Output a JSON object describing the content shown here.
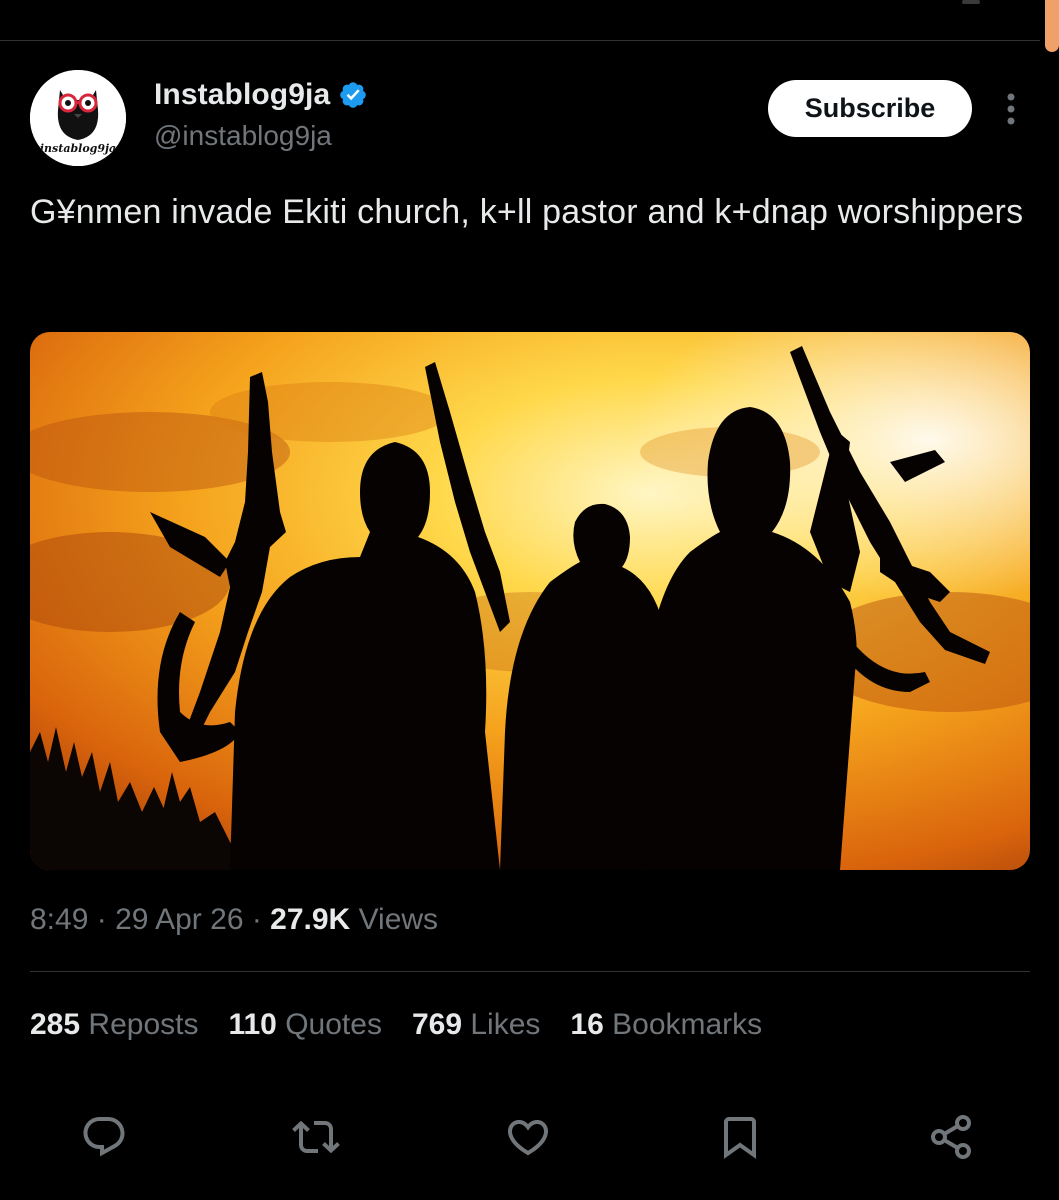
{
  "author": {
    "display_name": "Instablog9ja",
    "handle": "@instablog9ja",
    "avatar_text": "instablog9ja",
    "verified": true
  },
  "header": {
    "subscribe_label": "Subscribe"
  },
  "post": {
    "text": "G¥nmen invade Ekiti church, k+ll pastor and k+dnap worshippers",
    "time": "8:49",
    "date": "29 Apr 26",
    "views_count": "27.9K",
    "views_label": "Views"
  },
  "stats": [
    {
      "count": "285",
      "label": "Reposts"
    },
    {
      "count": "110",
      "label": "Quotes"
    },
    {
      "count": "769",
      "label": "Likes"
    },
    {
      "count": "16",
      "label": "Bookmarks"
    }
  ],
  "actions": [
    {
      "name": "reply",
      "icon": "reply-icon"
    },
    {
      "name": "repost",
      "icon": "repost-icon"
    },
    {
      "name": "like",
      "icon": "heart-icon"
    },
    {
      "name": "bookmark",
      "icon": "bookmark-icon"
    },
    {
      "name": "share",
      "icon": "share-icon"
    }
  ],
  "colors": {
    "background": "#000000",
    "text_primary": "#e7e9ea",
    "text_secondary": "#71767b",
    "verified_blue": "#1d9bf0",
    "divider": "#2f3336"
  }
}
